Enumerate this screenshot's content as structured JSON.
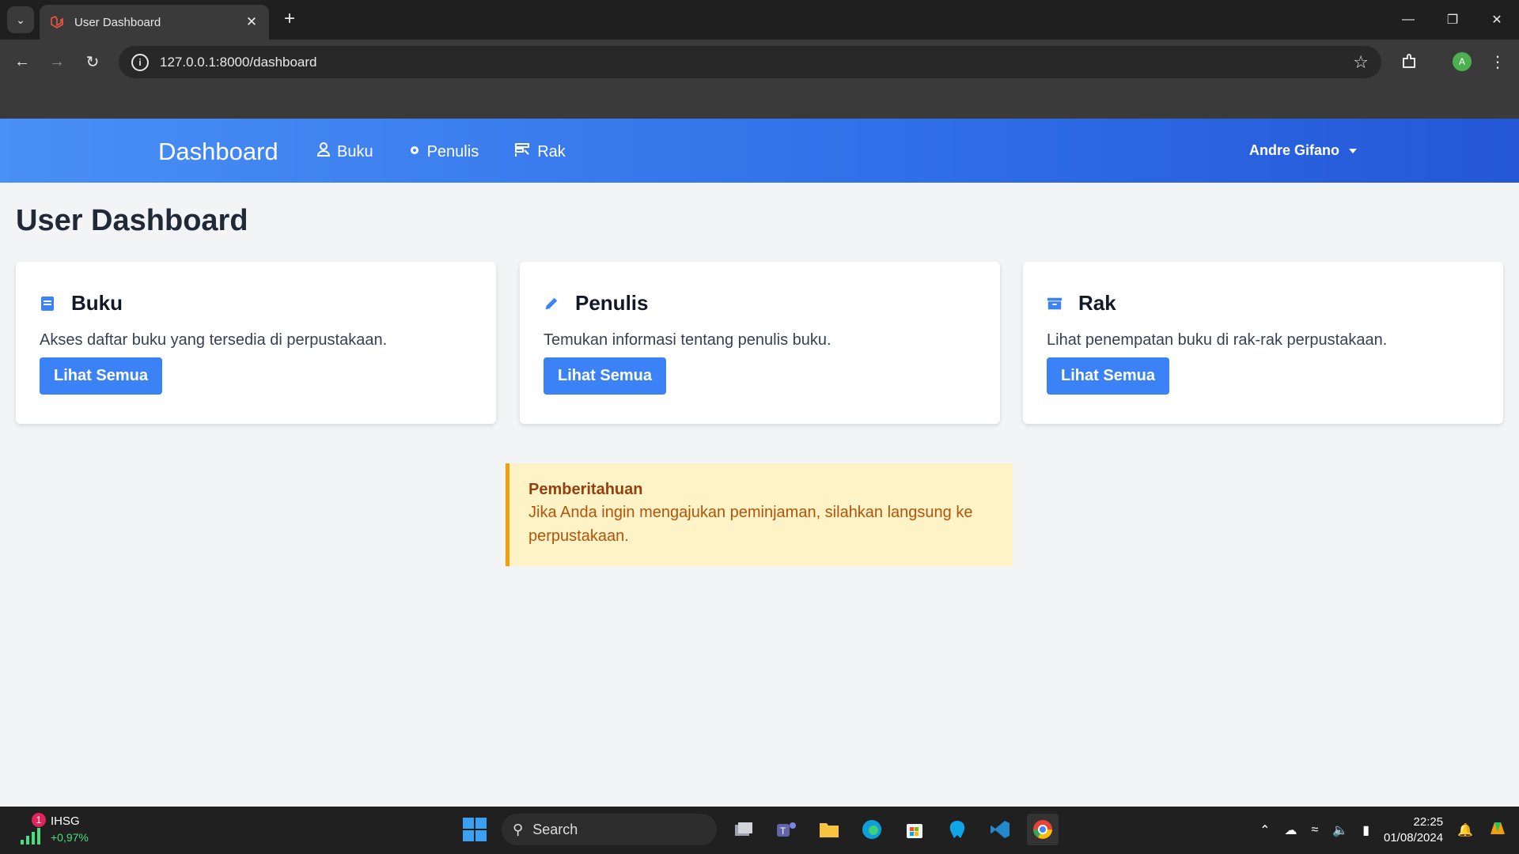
{
  "browser": {
    "tab_title": "User Dashboard",
    "url": "127.0.0.1:8000/dashboard",
    "profile_initial": "A"
  },
  "navbar": {
    "brand": "Dashboard",
    "links": [
      {
        "label": "Buku",
        "icon": "user-icon"
      },
      {
        "label": "Penulis",
        "icon": "gear-icon"
      },
      {
        "label": "Rak",
        "icon": "shelf-icon"
      }
    ],
    "user_name": "Andre Gifano"
  },
  "page": {
    "title": "User Dashboard"
  },
  "cards": [
    {
      "title": "Buku",
      "icon": "book-icon",
      "description": "Akses daftar buku yang tersedia di perpustakaan.",
      "button": "Lihat Semua"
    },
    {
      "title": "Penulis",
      "icon": "pencil-icon",
      "description": "Temukan informasi tentang penulis buku.",
      "button": "Lihat Semua"
    },
    {
      "title": "Rak",
      "icon": "archive-icon",
      "description": "Lihat penempatan buku di rak-rak perpustakaan.",
      "button": "Lihat Semua"
    }
  ],
  "notice": {
    "title": "Pemberitahuan",
    "text": "Jika Anda ingin mengajukan peminjaman, silahkan langsung ke perpustakaan."
  },
  "taskbar": {
    "widget_badge": "1",
    "widget_label": "IHSG",
    "widget_change": "+0,97%",
    "search_placeholder": "Search",
    "time": "22:25",
    "date": "01/08/2024"
  },
  "colors": {
    "accent": "#3b82f6",
    "notice_bg": "#fef3c7",
    "notice_border": "#f59e0b"
  }
}
